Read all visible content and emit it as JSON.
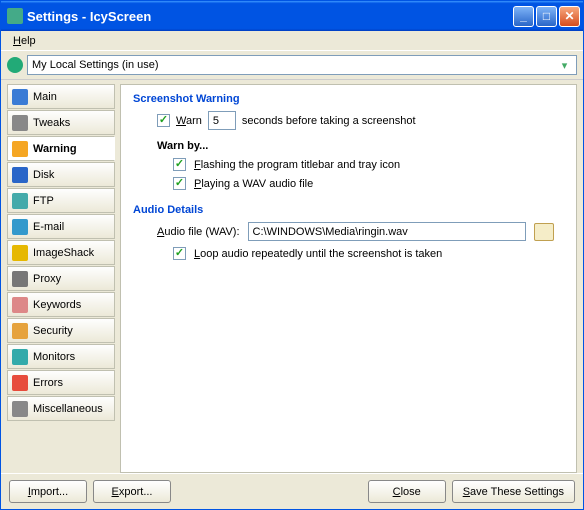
{
  "window": {
    "title": "Settings - IcyScreen"
  },
  "menu": {
    "help": "Help"
  },
  "profile": {
    "label": "My Local Settings (in use)"
  },
  "sidebar": {
    "items": [
      {
        "label": "Main",
        "color": "#3a7bd5"
      },
      {
        "label": "Tweaks",
        "color": "#888"
      },
      {
        "label": "Warning",
        "color": "#f5a623",
        "active": true
      },
      {
        "label": "Disk",
        "color": "#2a66c8"
      },
      {
        "label": "FTP",
        "color": "#4aa"
      },
      {
        "label": "E-mail",
        "color": "#39c"
      },
      {
        "label": "ImageShack",
        "color": "#e6b800"
      },
      {
        "label": "Proxy",
        "color": "#777"
      },
      {
        "label": "Keywords",
        "color": "#d88"
      },
      {
        "label": "Security",
        "color": "#e6a23c"
      },
      {
        "label": "Monitors",
        "color": "#3aa"
      },
      {
        "label": "Errors",
        "color": "#e74c3c"
      },
      {
        "label": "Miscellaneous",
        "color": "#888"
      }
    ]
  },
  "content": {
    "section1": "Screenshot Warning",
    "warn_label": "Warn",
    "warn_value": "5",
    "warn_suffix": "seconds before taking a screenshot",
    "warn_by": "Warn by...",
    "opt_flash": "Flashing the program titlebar and tray icon",
    "opt_wav": "Playing a WAV audio file",
    "section2": "Audio Details",
    "audio_label": "Audio file (WAV):",
    "audio_value": "C:\\WINDOWS\\Media\\ringin.wav",
    "opt_loop": "Loop audio repeatedly until the screenshot is taken"
  },
  "buttons": {
    "import": "Import...",
    "export": "Export...",
    "close": "Close",
    "save": "Save These Settings"
  }
}
